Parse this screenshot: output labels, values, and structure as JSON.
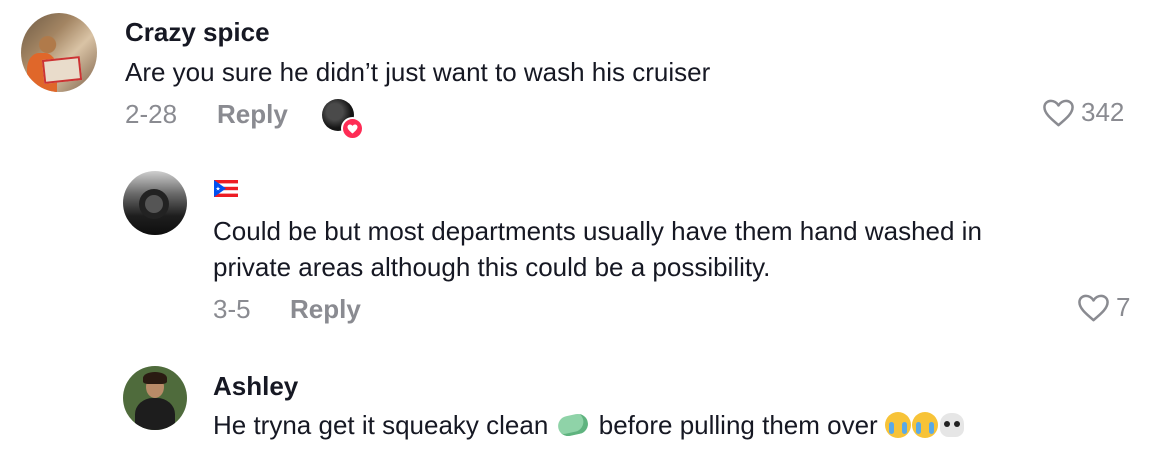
{
  "comments": [
    {
      "username": "Crazy spice",
      "text": "Are you sure he didn’t just want to wash his cruiser",
      "date": "2-28",
      "reply_label": "Reply",
      "likes": "342",
      "creator_liked": true
    },
    {
      "username": "",
      "flag": "puerto-rico-flag",
      "text_lines": [
        "Could be but most departments usually have them hand washed in",
        "private areas although this could be a possibility."
      ],
      "date": "3-5",
      "reply_label": "Reply",
      "likes": "7"
    },
    {
      "username": "Ashley",
      "text_parts": [
        "He tryna get it squeaky clean",
        "before pulling them over"
      ],
      "emojis": [
        "soap-emoji",
        "loudly-crying-face-emoji",
        "loudly-crying-face-emoji",
        "skull-emoji"
      ]
    }
  ],
  "colors": {
    "text": "#161823",
    "muted": "#8a8b91",
    "accent": "#fe2c55"
  }
}
